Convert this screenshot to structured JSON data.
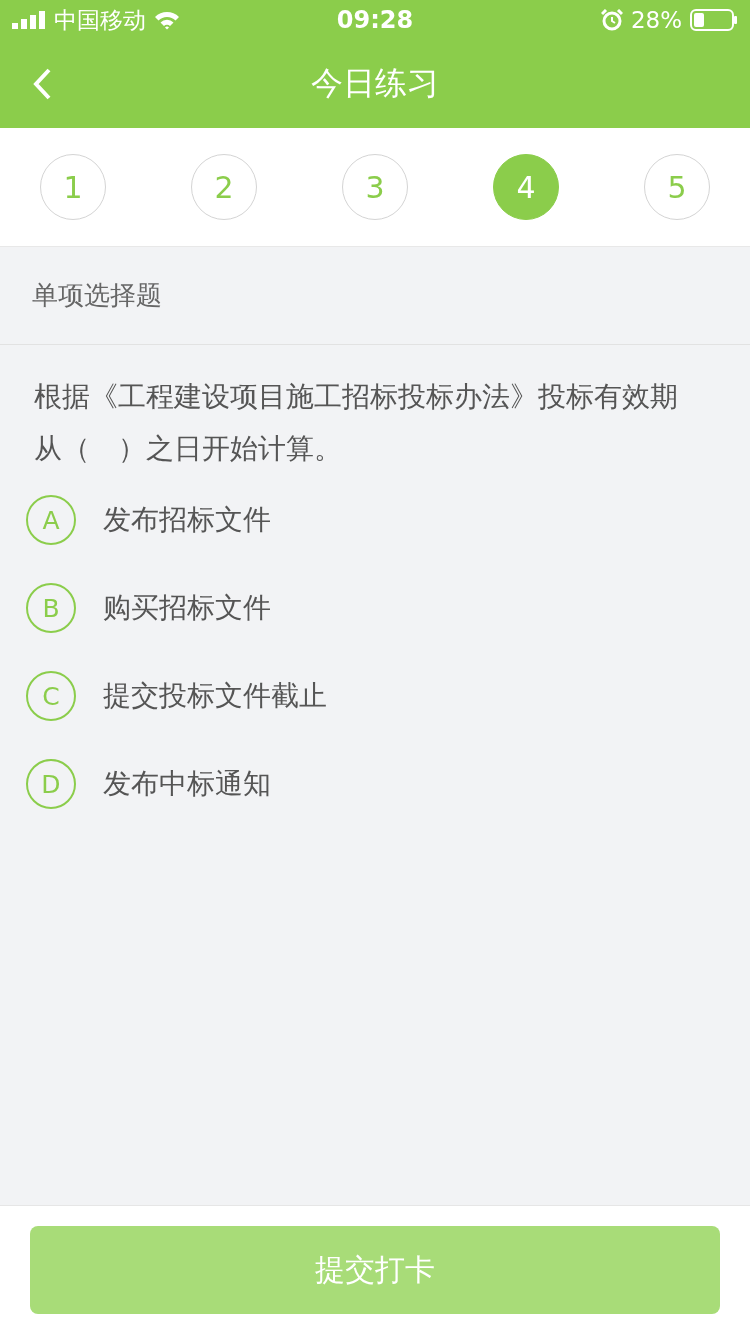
{
  "status_bar": {
    "carrier": "中国移动",
    "time": "09:28",
    "battery": "28%"
  },
  "nav": {
    "title": "今日练习"
  },
  "steps": [
    {
      "label": "1",
      "selected": false
    },
    {
      "label": "2",
      "selected": false
    },
    {
      "label": "3",
      "selected": false
    },
    {
      "label": "4",
      "selected": true
    },
    {
      "label": "5",
      "selected": false
    }
  ],
  "section": {
    "title": "单项选择题"
  },
  "question": {
    "text": "根据《工程建设项目施工招标投标办法》投标有效期从（　）之日开始计算。",
    "options": [
      {
        "letter": "A",
        "text": "发布招标文件",
        "selected": false
      },
      {
        "letter": "B",
        "text": "购买招标文件",
        "selected": false
      },
      {
        "letter": "C",
        "text": "提交投标文件截止",
        "selected": false
      },
      {
        "letter": "D",
        "text": "发布中标通知",
        "selected": false
      }
    ]
  },
  "submit": {
    "label": "提交打卡",
    "disabled": true
  }
}
